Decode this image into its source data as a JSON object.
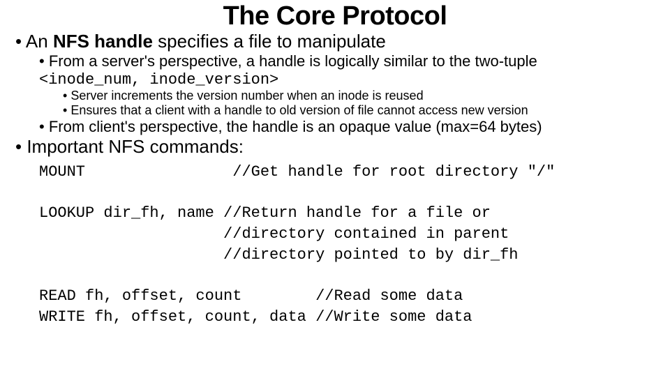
{
  "title": "The Core Protocol",
  "b1": {
    "pre": "An ",
    "bold": "NFS handle",
    "post": " specifies a file to manipulate"
  },
  "b1_1": {
    "pre": "From a server's perspective, a handle is logically similar to the two-tuple ",
    "mono": "<inode_num, inode_version>"
  },
  "b1_1_1": "Server increments the version number when an inode is reused",
  "b1_1_2": "Ensures that a client with a handle to old version of file cannot access new version",
  "b1_2": "From client's perspective, the handle is an opaque value (max=64 bytes)",
  "b2": "Important NFS commands:",
  "cmds": "MOUNT                //Get handle for root directory \"/\"\n\nLOOKUP dir_fh, name //Return handle for a file or\n                    //directory contained in parent\n                    //directory pointed to by dir_fh\n\nREAD fh, offset, count        //Read some data\nWRITE fh, offset, count, data //Write some data"
}
